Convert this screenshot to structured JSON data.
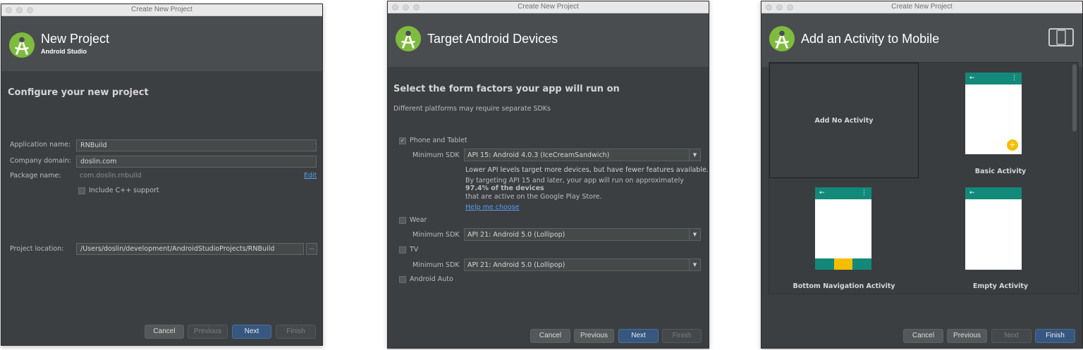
{
  "window_title": "Create New Project",
  "dialogs": {
    "configure": {
      "header_title": "New Project",
      "header_subtitle": "Android Studio",
      "section_title": "Configure your new project",
      "fields": {
        "app_name_label": "Application name:",
        "app_name_value": "RNBuild",
        "company_domain_label": "Company domain:",
        "company_domain_value": "doslin.com",
        "package_name_label": "Package name:",
        "package_name_value": "com.doslin.rnbuild",
        "edit_link": "Edit",
        "cpp_support_label": "Include C++ support",
        "project_location_label": "Project location:",
        "project_location_value": "/Users/doslin/development/AndroidStudioProjects/RNBuild",
        "browse_label": "..."
      },
      "buttons": {
        "cancel": "Cancel",
        "previous": "Previous",
        "next": "Next",
        "finish": "Finish"
      }
    },
    "targets": {
      "header_title": "Target Android Devices",
      "section_title": "Select the form factors your app will run on",
      "section_subtitle": "Different platforms may require separate SDKs",
      "phone": {
        "label": "Phone and Tablet",
        "checked": true,
        "min_sdk_label": "Minimum SDK",
        "min_sdk_value": "API 15: Android 4.0.3 (IceCreamSandwich)",
        "info_line1": "Lower API levels target more devices, but have fewer features available.",
        "info_line2": "By targeting API 15 and later, your app will run on approximately",
        "info_line3": "97.4% of the devices",
        "info_line4": "that are active on the Google Play Store.",
        "help_link": "Help me choose"
      },
      "wear": {
        "label": "Wear",
        "min_sdk_label": "Minimum SDK",
        "min_sdk_value": "API 21: Android 5.0 (Lollipop)"
      },
      "tv": {
        "label": "TV",
        "min_sdk_label": "Minimum SDK",
        "min_sdk_value": "API 21: Android 5.0 (Lollipop)"
      },
      "auto": {
        "label": "Android Auto"
      },
      "buttons": {
        "cancel": "Cancel",
        "previous": "Previous",
        "next": "Next",
        "finish": "Finish"
      }
    },
    "activity": {
      "header_title": "Add an Activity to Mobile",
      "tiles": {
        "no_activity": "Add No Activity",
        "basic": "Basic Activity",
        "bottom_nav": "Bottom Navigation Activity",
        "empty": "Empty Activity"
      },
      "phone_back_glyph": "←",
      "phone_menu_glyph": "⋮",
      "fab_glyph": "+",
      "buttons": {
        "cancel": "Cancel",
        "previous": "Previous",
        "next": "Next",
        "finish": "Finish"
      }
    }
  },
  "colors": {
    "dialog_bg": "#3c3f41",
    "header_bg": "#4a4d4f",
    "primary_button": "#365880",
    "link": "#589df6",
    "app_bar": "#13897a",
    "fab": "#f6be00",
    "logo_green": "#7fbb3f"
  },
  "icons": [
    "android-studio-logo-icon",
    "checkbox-icon",
    "dropdown-arrow-icon",
    "device-form-factor-icon",
    "back-arrow-icon",
    "overflow-menu-icon",
    "fab-add-icon"
  ]
}
